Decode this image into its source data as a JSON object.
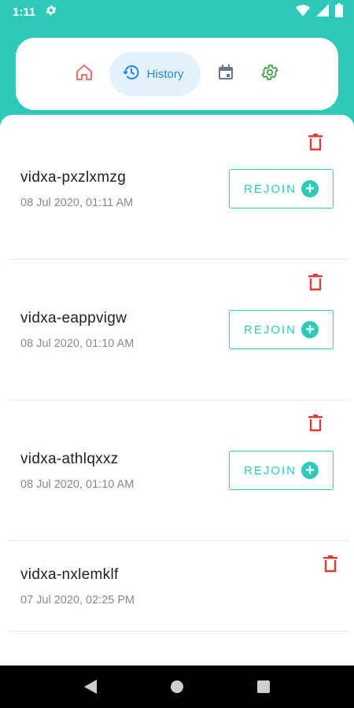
{
  "status_bar": {
    "time": "1:11"
  },
  "nav": {
    "active_label": "History",
    "icons": [
      "home-icon",
      "history-icon",
      "calendar-icon",
      "settings-icon"
    ],
    "colors": {
      "home": "#e57373",
      "history": "#1e88e5",
      "calendar": "#6b7a8a",
      "settings": "#43a047"
    }
  },
  "history": {
    "rejoin_label": "REJOIN",
    "items": [
      {
        "name": "vidxa-pxzlxmzg",
        "date": "08 Jul 2020, 01:11 AM"
      },
      {
        "name": "vidxa-eappvigw",
        "date": "08 Jul 2020, 01:10 AM"
      },
      {
        "name": "vidxa-athlqxxz",
        "date": "08 Jul 2020, 01:10 AM"
      },
      {
        "name": "vidxa-nxlemklf",
        "date": "07 Jul 2020, 02:25 PM"
      }
    ]
  },
  "theme": {
    "accent": "#2ec9b9",
    "danger": "#e53935"
  }
}
